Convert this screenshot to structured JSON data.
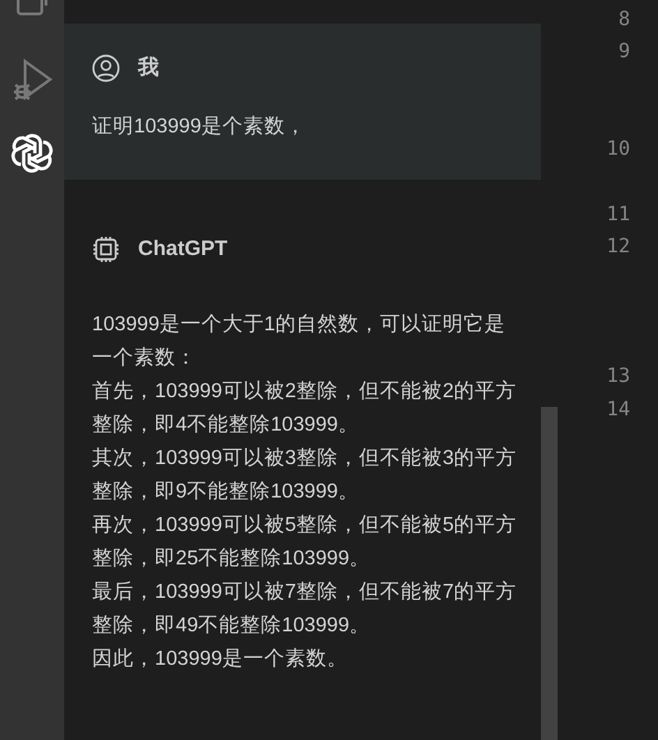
{
  "activity_bar": {
    "items": [
      {
        "kind": "extensions",
        "selected": false
      },
      {
        "kind": "run-debug",
        "selected": false
      },
      {
        "kind": "chat",
        "selected": true
      }
    ]
  },
  "chat": {
    "messages": [
      {
        "kind": "user",
        "author": "我",
        "paragraphs": [
          "证明103999是个素数，"
        ]
      },
      {
        "kind": "assistant",
        "author": "ChatGPT",
        "paragraphs": [
          "103999是一个大于1的自然数，可以证明它是一个素数：",
          "首先，103999可以被2整除，但不能被2的平方整除，即4不能整除103999。",
          "其次，103999可以被3整除，但不能被3的平方整除，即9不能整除103999。",
          "再次，103999可以被5整除，但不能被5的平方整除，即25不能整除103999。",
          "最后，103999可以被7整除，但不能被7的平方整除，即49不能整除103999。",
          "因此，103999是一个素数。"
        ]
      }
    ]
  },
  "editor": {
    "line_numbers": [
      "8",
      "9",
      "10",
      "11",
      "12",
      "13",
      "14"
    ]
  }
}
